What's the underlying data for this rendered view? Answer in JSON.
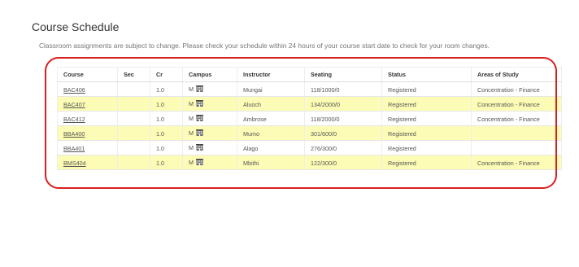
{
  "title": "Course Schedule",
  "notice": "Classroom assignments are subject to change. Please check your schedule within 24 hours of your course start date to check for your room changes.",
  "table": {
    "headers": [
      "Course",
      "Sec",
      "Cr",
      "Campus",
      "Instructor",
      "Seating",
      "Status",
      "Areas of Study"
    ],
    "rows": [
      {
        "course": "BAC406",
        "sec": "",
        "cr": "1.0",
        "campus": "M",
        "instructor": "Mungai",
        "seating": "118/1000/0",
        "status": "Registered",
        "area": "Concentration - Finance",
        "highlight": false
      },
      {
        "course": "BAC407",
        "sec": "",
        "cr": "1.0",
        "campus": "M",
        "instructor": "Aluoch",
        "seating": "134/2000/0",
        "status": "Registered",
        "area": "Concentration - Finance",
        "highlight": true
      },
      {
        "course": "BAC412",
        "sec": "",
        "cr": "1.0",
        "campus": "M",
        "instructor": "Ambrose",
        "seating": "118/2000/0",
        "status": "Registered",
        "area": "Concentration - Finance",
        "highlight": false
      },
      {
        "course": "BBA400",
        "sec": "",
        "cr": "1.0",
        "campus": "M",
        "instructor": "Mumo",
        "seating": "301/600/0",
        "status": "Registered",
        "area": "",
        "highlight": true
      },
      {
        "course": "BBA401",
        "sec": "",
        "cr": "1.0",
        "campus": "M",
        "instructor": "Alago",
        "seating": "276/300/0",
        "status": "Registered",
        "area": "",
        "highlight": false
      },
      {
        "course": "BMS404",
        "sec": "",
        "cr": "1.0",
        "campus": "M",
        "instructor": "Mbithi",
        "seating": "122/300/0",
        "status": "Registered",
        "area": "Concentration - Finance",
        "highlight": true
      }
    ]
  },
  "colors": {
    "highlight_row": "#fcfcb6",
    "annotation_outline": "#d91e1e"
  },
  "icons": {
    "campus": "building-icon"
  }
}
